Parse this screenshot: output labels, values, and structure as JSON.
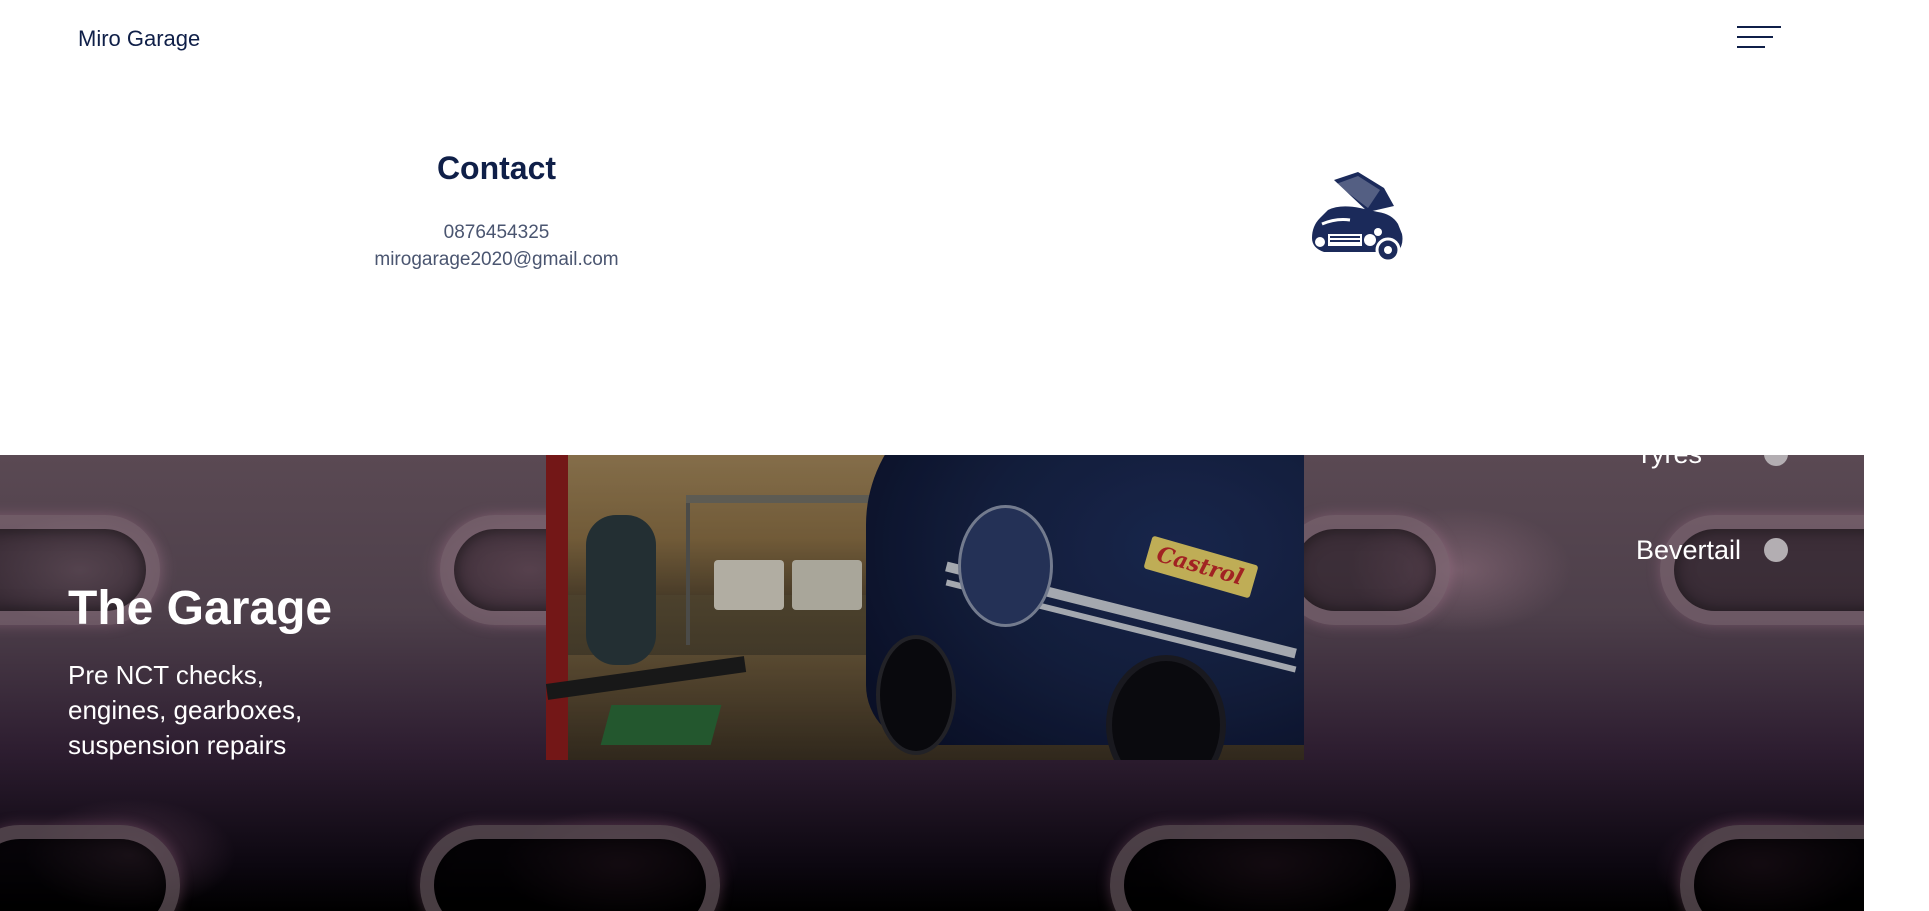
{
  "header": {
    "brand": "Miro Garage",
    "menu_icon": "hamburger-menu-icon"
  },
  "contact": {
    "title": "Contact",
    "phone": "0876454325",
    "email": "mirogarage2020@gmail.com"
  },
  "logo": {
    "icon": "car-hood-open-icon",
    "color": "#1b2a5a"
  },
  "hero": {
    "title": "The Garage",
    "subtitle": "Pre NCT checks, engines, gearboxes, suspension repairs",
    "photo_decal_text": "Castrol",
    "nav": [
      {
        "label": "Tyres"
      },
      {
        "label": "Bevertail"
      }
    ]
  },
  "colors": {
    "text_primary": "#0f1f48",
    "text_secondary": "#4a5570",
    "hero_text": "#ffffff",
    "nav_dot": "#b3aeb2"
  }
}
